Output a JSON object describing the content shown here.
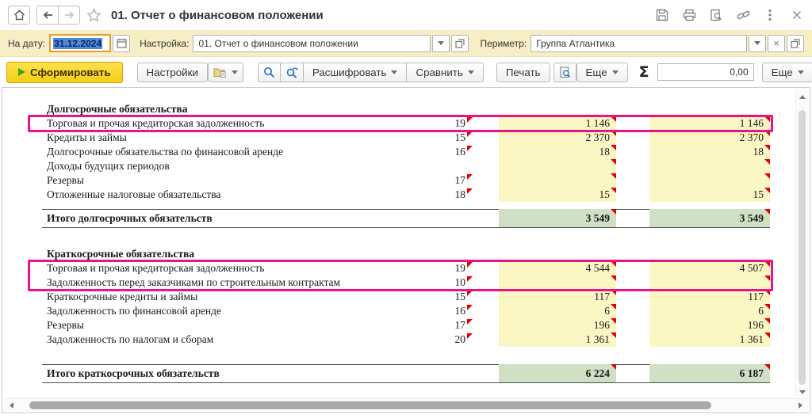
{
  "window": {
    "title": "01. Отчет о финансовом положении"
  },
  "filters": {
    "date_label": "На дату:",
    "date_value": "31.12.2024",
    "setting_label": "Настройка:",
    "setting_value": "01. Отчет о финансовом положении",
    "perimeter_label": "Периметр:",
    "perimeter_value": "Группа Атлантика"
  },
  "toolbar": {
    "generate_label": "Сформировать",
    "settings_label": "Настройки",
    "decipher_label": "Расшифровать",
    "compare_label": "Сравнить",
    "print_label": "Печать",
    "more_label": "Еще",
    "sigma_label": "Σ",
    "sum_value": "0,00",
    "more2_label": "Еще"
  },
  "icons": {
    "home": "house",
    "back": "←",
    "forward": "→",
    "favorite": "☆",
    "save": "floppy",
    "print": "printer",
    "preview": "page+magnifier",
    "link": "chain",
    "menu": "⋮",
    "close": "×",
    "calendar": "calendar-grid",
    "dropdown": "▾",
    "open": "overlapping-squares",
    "clear": "×",
    "save-settings": "folder",
    "search": "magnifier",
    "search-next": "magnifier+arrow",
    "play": "▶",
    "note_marker_color": "#e60000"
  },
  "colors": {
    "accent_yellow_cell": "#fbf7c5",
    "accent_green_cell": "#cfe0c4",
    "highlight_box": "#ee1288",
    "filter_bar": "#f8eec6",
    "generate_button": "#f7d426"
  },
  "report": {
    "sections": [
      {
        "title": "Долгосрочные обязательства",
        "rows": [
          {
            "label": "Торговая и прочая кредиторская задолженность",
            "code": "19",
            "marker": true,
            "col1": "1 146",
            "col2": "1 146",
            "highlight": true
          },
          {
            "label": "Кредиты и займы",
            "code": "15",
            "marker": true,
            "col1": "2 370",
            "col2": "2 370",
            "highlight": false
          },
          {
            "label": "Долгосрочные обязательства по финансовой аренде",
            "code": "16",
            "marker": true,
            "col1": "18",
            "col2": "18",
            "highlight": false
          },
          {
            "label": "Доходы будущих периодов",
            "code": "",
            "marker": false,
            "col1": "",
            "col2": "",
            "highlight": false
          },
          {
            "label": "Резервы",
            "code": "17",
            "marker": true,
            "col1": "",
            "col2": "",
            "highlight": false
          },
          {
            "label": "Отложенные налоговые обязательства",
            "code": "18",
            "marker": true,
            "col1": "15",
            "col2": "15",
            "highlight": false
          }
        ],
        "total": {
          "label": "Итого долгосрочных обязательств",
          "col1": "3 549",
          "col2": "3 549"
        }
      },
      {
        "title": "Краткосрочные обязательства",
        "rows": [
          {
            "label": "Торговая и прочая кредиторская задолженность",
            "code": "19",
            "marker": true,
            "col1": "4 544",
            "col2": "4 507",
            "highlight": true
          },
          {
            "label": "Задолженность перед заказчиками по строительным контрактам",
            "code": "10",
            "marker": true,
            "col1": "",
            "col2": "",
            "highlight": true
          },
          {
            "label": "Краткосрочные кредиты и займы",
            "code": "15",
            "marker": true,
            "col1": "117",
            "col2": "117",
            "highlight": false
          },
          {
            "label": "Задолженность по финансовой аренде",
            "code": "16",
            "marker": true,
            "col1": "6",
            "col2": "6",
            "highlight": false
          },
          {
            "label": "Резервы",
            "code": "17",
            "marker": true,
            "col1": "196",
            "col2": "196",
            "highlight": false
          },
          {
            "label": "Задолженность по налогам и сборам",
            "code": "20",
            "marker": true,
            "col1": "1 361",
            "col2": "1 361",
            "highlight": false
          }
        ],
        "total": {
          "label": "Итого краткосрочных обязательств",
          "col1": "6 224",
          "col2": "6 187"
        }
      }
    ]
  }
}
